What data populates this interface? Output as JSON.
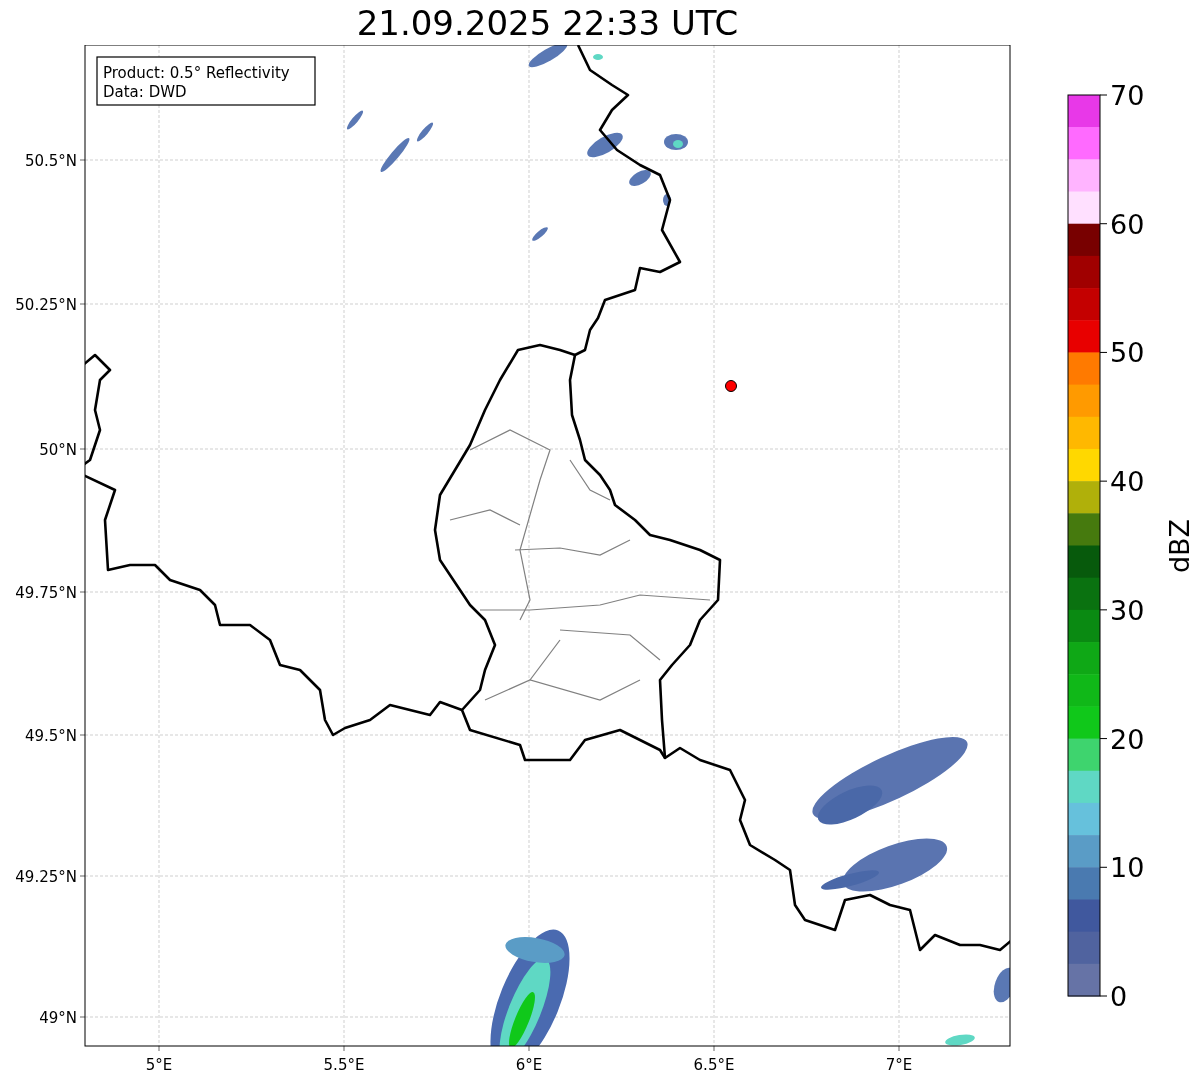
{
  "title": "21.09.2025 22:33 UTC",
  "info_box": {
    "lines": [
      "Product: 0.5° Reflectivity",
      "Data: DWD"
    ]
  },
  "map": {
    "x_ticks": [
      "5°E",
      "5.5°E",
      "6°E",
      "6.5°E",
      "7°E"
    ],
    "y_ticks": [
      "50.5°N",
      "50.25°N",
      "50°N",
      "49.75°N",
      "49.5°N",
      "49.25°N",
      "49°N"
    ]
  },
  "colorbar": {
    "label": "dBZ",
    "ticks": [
      "70",
      "60",
      "50",
      "40",
      "30",
      "20",
      "10",
      "0"
    ],
    "segments": [
      {
        "color": "#e838e8"
      },
      {
        "color": "#ff6aff"
      },
      {
        "color": "#ffb4ff"
      },
      {
        "color": "#ffe0ff"
      },
      {
        "color": "#780000"
      },
      {
        "color": "#a00000"
      },
      {
        "color": "#c40000"
      },
      {
        "color": "#e80000"
      },
      {
        "color": "#ff7a00"
      },
      {
        "color": "#ff9a00"
      },
      {
        "color": "#ffb800"
      },
      {
        "color": "#ffd800"
      },
      {
        "color": "#b0b00a"
      },
      {
        "color": "#467a0e"
      },
      {
        "color": "#075a0c"
      },
      {
        "color": "#0a7210"
      },
      {
        "color": "#0a8a12"
      },
      {
        "color": "#0fa816"
      },
      {
        "color": "#10b818"
      },
      {
        "color": "#10c81a"
      },
      {
        "color": "#3ed46e"
      },
      {
        "color": "#5fd8c4"
      },
      {
        "color": "#66c1dc"
      },
      {
        "color": "#5a9cc6"
      },
      {
        "color": "#4a7ab0"
      },
      {
        "color": "#40589e"
      },
      {
        "color": "#50639f"
      },
      {
        "color": "#6673a6"
      }
    ]
  }
}
